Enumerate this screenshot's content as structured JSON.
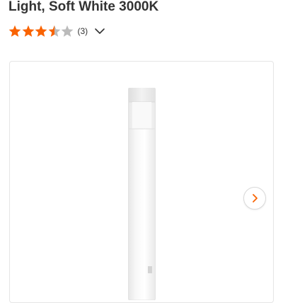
{
  "product": {
    "title_line": "Light, Soft White 3000K"
  },
  "rating": {
    "value": 3.5,
    "max": 5,
    "count_label": "(3)",
    "filled_color": "#f96302",
    "empty_color": "#bbbbbb"
  },
  "icons": {
    "rating_expand": "chevron-down-icon",
    "gallery_next": "chevron-right-icon"
  },
  "colors": {
    "accent": "#f96302"
  }
}
